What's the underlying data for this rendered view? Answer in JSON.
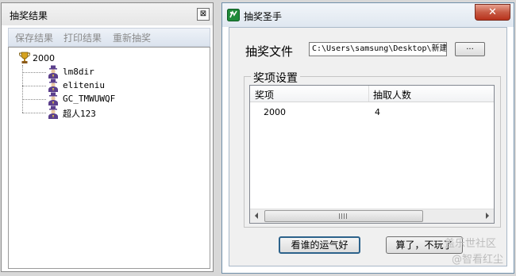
{
  "results_window": {
    "title": "抽奖结果",
    "close_glyph": "⊠",
    "toolbar": {
      "save": "保存结果",
      "print": "打印结果",
      "redraw": "重新抽奖"
    },
    "tree": {
      "root": "2000",
      "children": [
        "lm8dir",
        "eliteniu",
        "GC_TMWUWQF",
        "超人123"
      ]
    }
  },
  "main_window": {
    "title": "抽奖圣手",
    "close_glyph": "✕",
    "file_label": "抽奖文件",
    "file_path": "C:\\Users\\samsung\\Desktop\\新建",
    "browse_label": "...",
    "group_title": "奖项设置",
    "columns": [
      "奖项",
      "抽取人数"
    ],
    "rows": [
      [
        "2000",
        "4"
      ]
    ],
    "scroll_grip": "III",
    "lucky_button": "看谁的运气好",
    "quit_button": "算了，不玩了"
  },
  "watermarks": {
    "line1": "盖乐世社区",
    "line2": "@智看红尘"
  },
  "colors": {
    "close_red": "#c75a44",
    "app_icon_green": "#1f8a3a",
    "trophy_gold": "#d6a21e",
    "user_icon_purple": "#5b3f8c"
  }
}
